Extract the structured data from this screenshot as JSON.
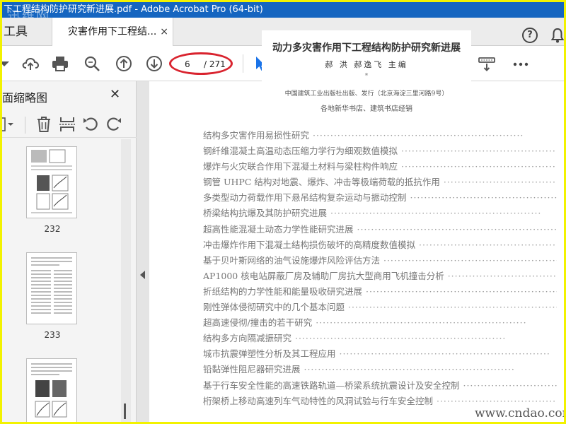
{
  "window": {
    "title": "下工程结构防护研究新进展.pdf - Adobe Acrobat Pro (64-bit)",
    "watermark": "迅维网"
  },
  "tabs": {
    "tools_label": "工具",
    "document_label": "灾害作用下工程结...",
    "close_glyph": "×"
  },
  "header_icons": {
    "help": "?",
    "notifications": "bell-icon"
  },
  "toolbar": {
    "page_current": "6",
    "page_total": "/ 271",
    "highlight_color": "#d9232e"
  },
  "left_panel": {
    "title": "页面缩略图",
    "close_glyph": "✕",
    "thumbnails": [
      {
        "label": "232"
      },
      {
        "label": "233"
      }
    ]
  },
  "document": {
    "book_title": "动力多灾害作用下工程结构防护研究新进展",
    "editors": "郝 洪 郝逸飞 主编",
    "star": "*",
    "publisher": "中国建筑工业出版社出版、发行（北京海淀三里河路9号）",
    "distribution": "各地新华书店、建筑书店经销",
    "toc": [
      "结构多灾害作用易损性研究",
      "钢纤维混凝土高温动态压缩力学行为细观数值模拟",
      "爆炸与火灾联合作用下混凝土材料与梁柱构件响应",
      "钢管 UHPC 结构对地震、爆炸、冲击等极端荷载的抵抗作用",
      "多类型动力荷载作用下悬吊结构复杂运动与振动控制",
      "桥梁结构抗爆及其防护研究进展",
      "超高性能混凝土动态力学性能研究进展",
      "冲击爆炸作用下混凝土结构损伤破坏的高精度数值模拟",
      "基于贝叶斯网络的油气设施爆炸风险评估方法",
      "AP1000 核电站屏蔽厂房及辅助厂房抗大型商用飞机撞击分析",
      "折纸结构的力学性能和能量吸收研究进展",
      "刚性弹体侵彻研究中的几个基本问题",
      "超高速侵彻/撞击的若干研究",
      "结构多方向隔减振研究",
      "城市抗震弹塑性分析及其工程应用",
      "铅黏弹性阻尼器研究进展",
      "基于行车安全性能的高速铁路轨道—桥梁系统抗震设计及安全控制",
      "桁架桥上移动高速列车气动特性的风洞试验与行车安全控制"
    ],
    "site_watermark": "www.cndao.com"
  },
  "colors": {
    "title_bar": "#1565c0",
    "frame": "#f2f200",
    "tool_icon": "#555555",
    "select_arrow": "#1a73e8"
  }
}
